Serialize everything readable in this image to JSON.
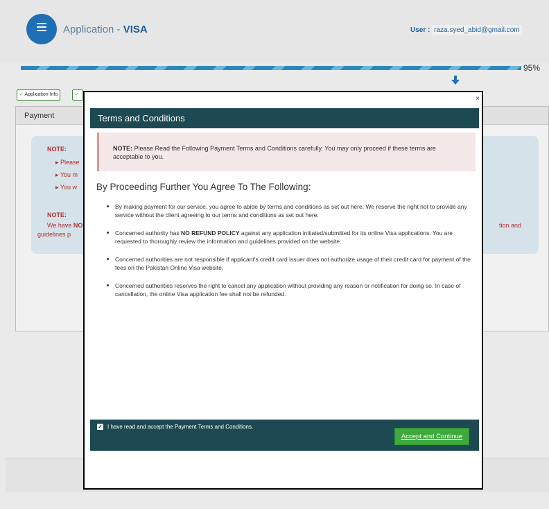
{
  "header": {
    "app_prefix": "Application - ",
    "app_name": "VISA",
    "user_label": "User :",
    "user_email": "raza.syed_abid@gmail.com"
  },
  "progress": {
    "value": 0.95,
    "label": "95%"
  },
  "steps": [
    {
      "label": "Application Info",
      "done": true
    },
    {
      "label": "",
      "done": true
    }
  ],
  "background_panel": {
    "title": "Payment",
    "note1_label": "NOTE:",
    "bullets": [
      "Please",
      "You m",
      "You w"
    ],
    "note2_label": "NOTE:",
    "note2_prefix": "We have ",
    "note2_bold": "NO",
    "note2_tail": "guidelines p",
    "note2_right": "tion and"
  },
  "modal": {
    "close_label": "×",
    "title": "Terms and Conditions",
    "alert_label": "NOTE:",
    "alert_text": " Please Read the Following Payment Terms and Conditions carefully. You may only proceed if these terms are acceptable to you.",
    "heading": "By Proceeding Further You Agree To The Following:",
    "terms": [
      {
        "before": "By making payment for our service, you agree to abide by terms and conditions as set out here. We reserve the right not to provide any service without the client agreeing to our terms and conditions as set out here.",
        "bold": "",
        "after": ""
      },
      {
        "before": "Concerned authority has ",
        "bold": "NO REFUND POLICY",
        "after": " against any application initiated/submitted for its online Visa applications. You are requested to thoroughly review the information and guidelines provided on the website."
      },
      {
        "before": "Concerned authorities are not responsible if applicant's credit card issuer does not authorize usage of their credit card for payment of the fees on the Pakistan Online Visa website.",
        "bold": "",
        "after": ""
      },
      {
        "before": "Concerned authorities reserves the right to cancel any application without providing any reason or notification for doing so. In case of cancellation, the online Visa application fee shall not be refunded.",
        "bold": "",
        "after": ""
      }
    ],
    "accept_checked": true,
    "accept_label": "I have read and accept the Payment Terms and Conditions.",
    "button_label": "Accept and Continue"
  },
  "colors": {
    "modal_header": "#1d4a52",
    "accept_button": "#3eaa3e",
    "alert_bg": "#f5e8e8",
    "note_text": "#b03030",
    "progress": "#2b88b8"
  },
  "icons": {
    "logo": "menu-icon",
    "download": "arrow-down-icon",
    "close": "close-icon",
    "check": "check-icon"
  }
}
